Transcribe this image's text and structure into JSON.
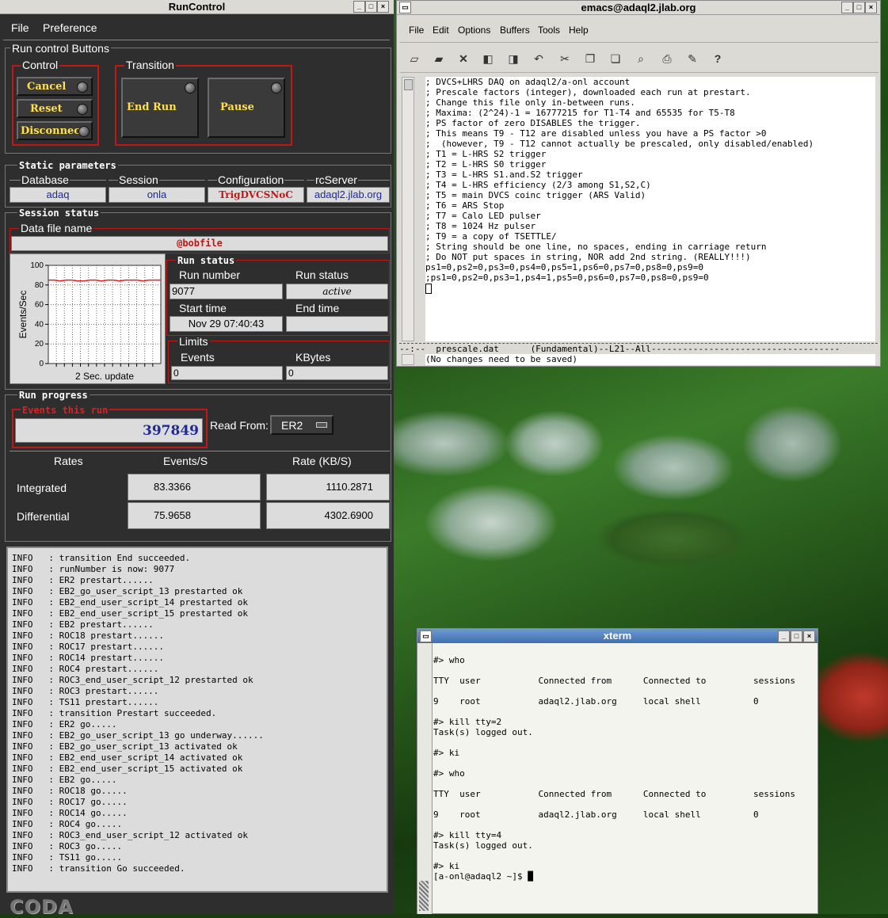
{
  "runcontrol": {
    "title": "RunControl",
    "menu": [
      "File",
      "Preference"
    ],
    "run_control_buttons_label": "Run control Buttons",
    "control_label": "Control",
    "transition_label": "Transition",
    "control_buttons": [
      "Cancel",
      "Reset",
      "Disconnect"
    ],
    "transition_buttons": [
      "End Run",
      "Pause"
    ],
    "static_params_label": "Static parameters",
    "static_headers": [
      "Database",
      "Session",
      "Configuration",
      "rcServer"
    ],
    "static_values": [
      "adaq",
      "onla",
      "TrigDVCSNoC",
      "adaql2.jlab.org"
    ],
    "session_status_label": "Session status",
    "data_file_label": "Data file name",
    "data_file_value": "@bobfile",
    "chart_data": {
      "type": "line",
      "ylabel": "Events/Sec",
      "xlabel": "2 Sec. update",
      "ylim": [
        0,
        100
      ],
      "y_ticks": [
        "100",
        "80",
        "60",
        "40",
        "20",
        "0"
      ],
      "series": [
        {
          "values": [
            85,
            85,
            84,
            85,
            85,
            84,
            84,
            85,
            85,
            84,
            85,
            85,
            84,
            85,
            85,
            85,
            84,
            85,
            85,
            85
          ]
        }
      ],
      "color": "#e02020"
    },
    "run_status_label": "Run status",
    "run_number_label": "Run number",
    "run_number": "9077",
    "run_status_field_label": "Run status",
    "run_status_value": "active",
    "start_time_label": "Start time",
    "start_time": "Nov 29 07:40:43",
    "end_time_label": "End time",
    "end_time": "",
    "limits_label": "Limits",
    "events_label": "Events",
    "events_limit": "0",
    "kbytes_label": "KBytes",
    "kbytes_limit": "0",
    "run_progress_label": "Run progress",
    "events_this_run_label": "Events this run",
    "events_this_run": "397849",
    "read_from_label": "Read From:",
    "read_from_value": "ER2",
    "rates_header": [
      "Rates",
      "Events/S",
      "Rate (KB/S)"
    ],
    "integrated_label": "Integrated",
    "integrated_events": "83.3366",
    "integrated_rate": "1110.2871",
    "differential_label": "Differential",
    "differential_events": "75.9658",
    "differential_rate": "4302.6900",
    "log_lines": [
      "INFO   : transition End succeeded.",
      "INFO   : runNumber is now: 9077",
      "INFO   : ER2 prestart......",
      "INFO   : EB2_go_user_script_13 prestarted ok",
      "INFO   : EB2_end_user_script_14 prestarted ok",
      "INFO   : EB2_end_user_script_15 prestarted ok",
      "INFO   : EB2 prestart......",
      "INFO   : ROC18 prestart......",
      "INFO   : ROC17 prestart......",
      "INFO   : ROC14 prestart......",
      "INFO   : ROC4 prestart......",
      "INFO   : ROC3_end_user_script_12 prestarted ok",
      "INFO   : ROC3 prestart......",
      "INFO   : TS11 prestart......",
      "INFO   : transition Prestart succeeded.",
      "INFO   : ER2 go.....",
      "INFO   : EB2_go_user_script_13 go underway......",
      "INFO   : EB2_go_user_script_13 activated ok",
      "INFO   : EB2_end_user_script_14 activated ok",
      "INFO   : EB2_end_user_script_15 activated ok",
      "INFO   : EB2 go.....",
      "INFO   : ROC18 go.....",
      "INFO   : ROC17 go.....",
      "INFO   : ROC14 go.....",
      "INFO   : ROC4 go.....",
      "INFO   : ROC3_end_user_script_12 activated ok",
      "INFO   : ROC3 go.....",
      "INFO   : TS11 go.....",
      "INFO   : transition Go succeeded."
    ],
    "logo_text": "CODA"
  },
  "emacs": {
    "title": "emacs@adaql2.jlab.org",
    "menu": [
      "File",
      "Edit",
      "Options",
      "Buffers",
      "Tools",
      "Help"
    ],
    "toolbar_icons": [
      "new-file-icon",
      "open-folder-icon",
      "close-icon",
      "save-icon",
      "save-as-icon",
      "undo-icon",
      "cut-icon",
      "copy-icon",
      "paste-icon",
      "search-icon",
      "print-icon",
      "preferences-icon",
      "help-icon"
    ],
    "buffer_lines": [
      "; DVCS+LHRS DAQ on adaql2/a-onl account",
      "; Prescale factors (integer), downloaded each run at prestart.",
      "; Change this file only in-between runs.",
      "; Maxima: (2^24)-1 = 16777215 for T1-T4 and 65535 for T5-T8",
      "; PS factor of zero DISABLES the trigger.",
      "; This means T9 - T12 are disabled unless you have a PS factor >0",
      ";  (however, T9 - T12 cannot actually be prescaled, only disabled/enabled)",
      "; T1 = L-HRS S2 trigger",
      "; T2 = L-HRS S0 trigger",
      "; T3 = L-HRS S1.and.S2 trigger",
      "; T4 = L-HRS efficiency (2/3 among S1,S2,C)",
      "; T5 = main DVCS coinc trigger (ARS Valid)",
      "; T6 = ARS Stop",
      "; T7 = Calo LED pulser",
      "; T8 = 1024 Hz pulser",
      "; T9 = a copy of TSETTLE/",
      "; String should be one line, no spaces, ending in carriage return",
      "; Do NOT put spaces in string, NOR add 2nd string. (REALLY!!!)",
      "ps1=0,ps2=0,ps3=0,ps4=0,ps5=1,ps6=0,ps7=0,ps8=0,ps9=0",
      ";ps1=0,ps2=0,ps3=1,ps4=1,ps5=0,ps6=0,ps7=0,ps8=0,ps9=0",
      ""
    ],
    "mode_line": "--:--  prescale.dat      (Fundamental)--L21--All------------------------------------",
    "minibuffer": "(No changes need to be saved)"
  },
  "xterm": {
    "title": "xterm",
    "lines": [
      "",
      "#> who",
      "",
      "TTY  user           Connected from      Connected to         sessions",
      "",
      "9    root           adaql2.jlab.org     local shell          0",
      "",
      "#> kill tty=2",
      "Task(s) logged out.",
      "",
      "#> ki",
      "",
      "#> who",
      "",
      "TTY  user           Connected from      Connected to         sessions",
      "",
      "9    root           adaql2.jlab.org     local shell          0",
      "",
      "#> kill tty=4",
      "Task(s) logged out.",
      "",
      "#> ki",
      "[a-onl@adaql2 ~]$ █"
    ]
  }
}
